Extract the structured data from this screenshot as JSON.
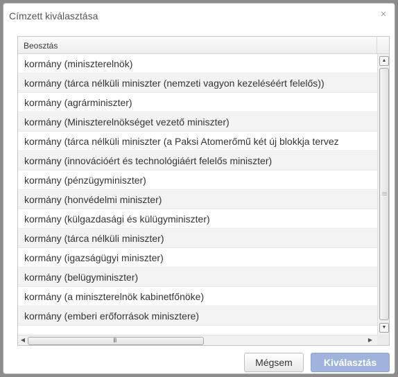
{
  "dialog": {
    "title": "Címzett kiválasztása",
    "close_glyph": "×"
  },
  "grid": {
    "column_header": "Beosztás",
    "rows": [
      "kormány (miniszterelnök)",
      "kormány (tárca nélküli miniszter (nemzeti vagyon kezeléséért felelős))",
      "kormány (agrárminiszter)",
      "kormány (Miniszterelnökséget vezető miniszter)",
      "kormány (tárca nélküli miniszter (a Paksi Atomerőmű két új blokkja tervez",
      "kormány (innovációért és technológiáért felelős miniszter)",
      "kormány (pénzügyminiszter)",
      "kormány (honvédelmi miniszter)",
      "kormány (külgazdasági és külügyminiszter)",
      "kormány (tárca nélküli miniszter)",
      "kormány (igazságügyi miniszter)",
      "kormány (belügyminiszter)",
      "kormány (a miniszterelnök kabinetfőnöke)",
      "kormány (emberi erőforrások minisztere)"
    ],
    "hscroll_grip": "III"
  },
  "buttons": {
    "cancel": "Mégsem",
    "select": "Kiválasztás"
  },
  "icons": {
    "close": "close-icon",
    "scroll_up": "arrow-up-icon",
    "scroll_down": "arrow-down-icon",
    "scroll_left": "arrow-left-icon",
    "scroll_right": "arrow-right-icon"
  },
  "colors": {
    "primary_button": "#9fb3dd",
    "alt_row": "#f3f3f3"
  }
}
